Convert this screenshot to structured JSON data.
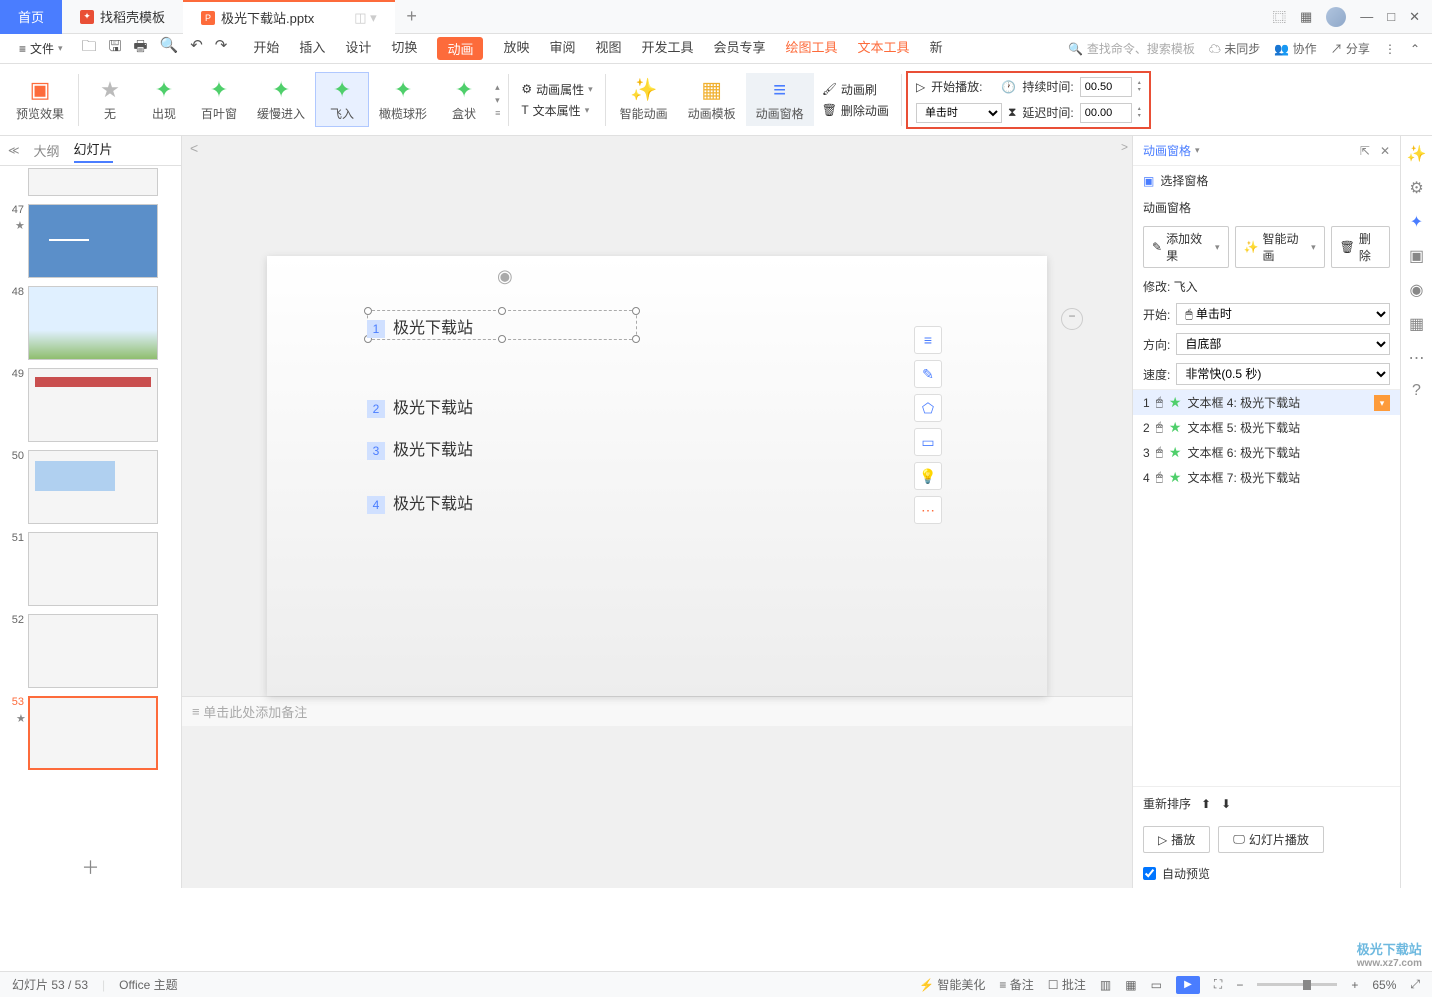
{
  "titlebar": {
    "tabs": [
      {
        "label": "首页",
        "type": "home"
      },
      {
        "label": "找稻壳模板",
        "type": "template"
      },
      {
        "label": "极光下载站.pptx",
        "type": "doc"
      }
    ]
  },
  "menu": {
    "file": "文件",
    "tabs": [
      "开始",
      "插入",
      "设计",
      "切换",
      "动画",
      "放映",
      "审阅",
      "视图",
      "开发工具",
      "会员专享",
      "绘图工具",
      "文本工具",
      "新"
    ],
    "active": "动画",
    "search_placeholder": "查找命令、搜索模板",
    "sync": "未同步",
    "collab": "协作",
    "share": "分享"
  },
  "ribbon": {
    "preview": "预览效果",
    "anims": [
      "无",
      "出现",
      "百叶窗",
      "缓慢进入",
      "飞入",
      "橄榄球形",
      "盒状"
    ],
    "selected": "飞入",
    "props": {
      "anim": "动画属性",
      "text": "文本属性"
    },
    "smart": "智能动画",
    "template": "动画模板",
    "pane": "动画窗格",
    "brush": "动画刷",
    "delete": "删除动画",
    "start_label": "开始播放:",
    "duration_label": "持续时间:",
    "delay_label": "延迟时间:",
    "start_val": "单击时",
    "duration_val": "00.50",
    "delay_val": "00.00"
  },
  "thumbs": {
    "tab_outline": "大纲",
    "tab_slides": "幻灯片",
    "items": [
      {
        "num": "47"
      },
      {
        "num": "48"
      },
      {
        "num": "49"
      },
      {
        "num": "50"
      },
      {
        "num": "51"
      },
      {
        "num": "52"
      },
      {
        "num": "53"
      }
    ],
    "selected": "53"
  },
  "slide": {
    "items": [
      {
        "n": "1",
        "t": "极光下载站"
      },
      {
        "n": "2",
        "t": "极光下载站"
      },
      {
        "n": "3",
        "t": "极光下载站"
      },
      {
        "n": "4",
        "t": "极光下载站"
      }
    ]
  },
  "notes_placeholder": "单击此处添加备注",
  "pane": {
    "title": "动画窗格",
    "select": "选择窗格",
    "header2": "动画窗格",
    "add": "添加效果",
    "smart": "智能动画",
    "del": "删除",
    "modify": "修改: 飞入",
    "start_lbl": "开始:",
    "start_val": "单击时",
    "dir_lbl": "方向:",
    "dir_val": "自底部",
    "speed_lbl": "速度:",
    "speed_val": "非常快(0.5 秒)",
    "list": [
      {
        "idx": "1",
        "t": "文本框 4: 极光下载站"
      },
      {
        "idx": "2",
        "t": "文本框 5: 极光下载站"
      },
      {
        "idx": "3",
        "t": "文本框 6: 极光下载站"
      },
      {
        "idx": "4",
        "t": "文本框 7: 极光下载站"
      }
    ],
    "reorder": "重新排序",
    "play": "播放",
    "slideshow": "幻灯片播放",
    "auto": "自动预览"
  },
  "status": {
    "slide": "幻灯片 53 / 53",
    "theme": "Office 主题",
    "beautify": "智能美化",
    "notes": "备注",
    "comments": "批注",
    "zoom": "65%"
  },
  "watermark": {
    "brand": "极光下载站",
    "url": "www.xz7.com"
  }
}
